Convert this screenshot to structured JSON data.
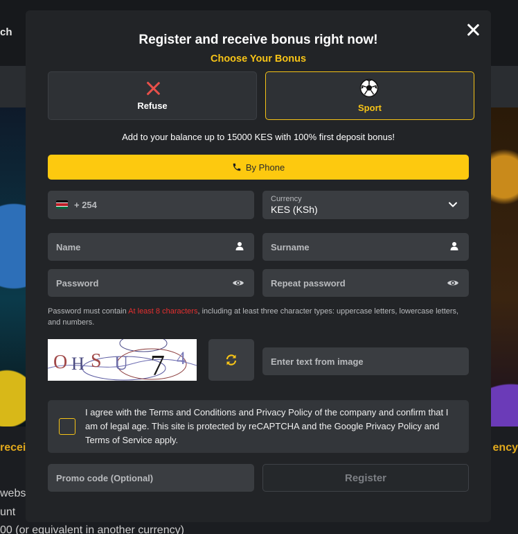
{
  "background": {
    "top_text": "ch",
    "left_heading": "recei",
    "right_heading": "ency",
    "lines": [
      "webs",
      "unt",
      "00 (or equivalent in another currency)"
    ]
  },
  "modal": {
    "title": "Register and receive bonus right now!",
    "subtitle": "Choose Your Bonus",
    "bonuses": [
      {
        "label": "Refuse",
        "icon": "close-x-icon"
      },
      {
        "label": "Sport",
        "icon": "soccer-ball-icon",
        "selected": true
      }
    ],
    "balance_text": "Add to your balance up to 15000 KES with 100% first deposit bonus!",
    "phone_tab": {
      "label": "By Phone",
      "icon": "phone-icon"
    },
    "phone": {
      "prefix": "+ 254",
      "flag": "kenya-flag-icon"
    },
    "currency": {
      "label": "Currency",
      "value": "KES (KSh)"
    },
    "name_placeholder": "Name",
    "surname_placeholder": "Surname",
    "password_placeholder": "Password",
    "repeat_password_placeholder": "Repeat password",
    "password_note": {
      "before": "Password must contain ",
      "highlight": "At least 8 characters",
      "after": ", including at least three character types: uppercase letters, lowercase letters, and numbers."
    },
    "captcha": {
      "text": "OHSU74",
      "input_placeholder": "Enter text from image"
    },
    "agree_text": "I agree with the Terms and Conditions and Privacy Policy of the company and confirm that I am of legal age. This site is protected by reCAPTCHA and the Google Privacy Policy and Terms of Service apply.",
    "promo_placeholder": "Promo code (Optional)",
    "register_label": "Register",
    "colors": {
      "accent": "#fdc90f",
      "danger": "#e52f2f",
      "modal_bg": "#222427",
      "field_bg": "#3a3d41"
    }
  }
}
